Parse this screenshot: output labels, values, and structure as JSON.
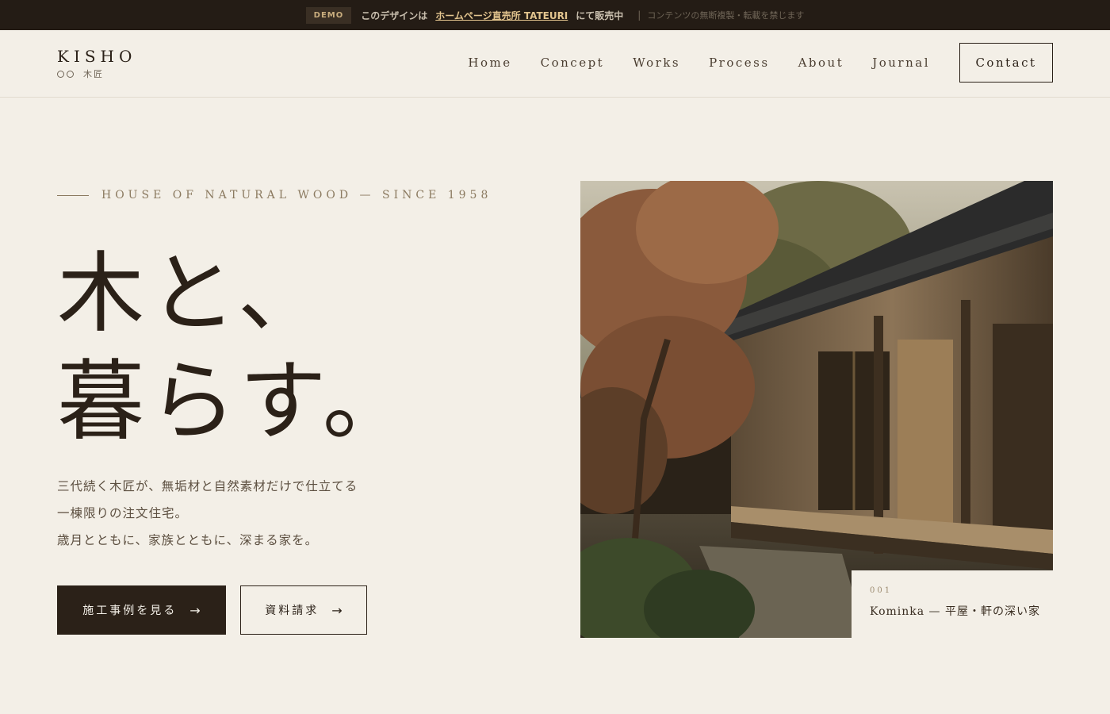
{
  "demo_bar": {
    "badge": "DEMO",
    "text": "このデザインは",
    "link": "ホームページ直売所 TATEURI",
    "after": "にて販売中",
    "separator": "|",
    "note": "コンテンツの無断複製・転載を禁じます"
  },
  "header": {
    "logo": "KISHO",
    "logo_sub": "木匠",
    "nav": [
      "Home",
      "Concept",
      "Works",
      "Process",
      "About",
      "Journal"
    ],
    "contact": "Contact"
  },
  "hero": {
    "eyebrow": "HOUSE OF NATURAL WOOD — SINCE 1958",
    "headline": [
      "木と、",
      "暮らす。"
    ],
    "lead": [
      "三代続く木匠が、無垢材と自然素材だけで仕立てる",
      "一棟限りの注文住宅。",
      "歳月とともに、家族とともに、深まる家を。"
    ],
    "primary_button": "施工事例を見る",
    "secondary_button": "資料請求",
    "arrow": "→",
    "caption": {
      "number": "001",
      "title": "Kominka — 平屋・軒の深い家"
    }
  },
  "colors": {
    "background": "#f3efe7",
    "ink": "#2b2118",
    "demo_bar": "#241c15",
    "accent_gold": "#e2c48e"
  }
}
